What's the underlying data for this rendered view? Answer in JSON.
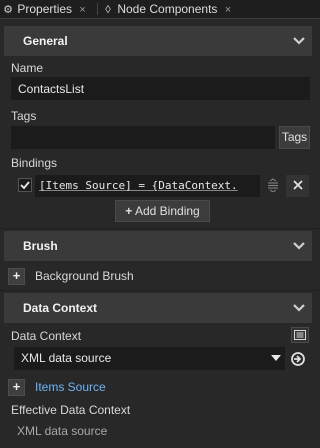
{
  "tabs": [
    {
      "label": "Properties",
      "icon": "gear-icon",
      "close": "×"
    },
    {
      "label": "Node Components",
      "icon": "components-icon",
      "close": "×"
    }
  ],
  "general": {
    "title": "General",
    "name_label": "Name",
    "name_value": "ContactsList",
    "tags_label": "Tags",
    "tags_value": "",
    "tags_button": "Tags",
    "bindings_label": "Bindings",
    "binding_text": "[Items Source] = {DataContext.",
    "binding_checked": true,
    "add_binding_label": "Add Binding"
  },
  "brush": {
    "title": "Brush",
    "background_brush_label": "Background Brush"
  },
  "data_context": {
    "title": "Data Context",
    "label": "Data Context",
    "selected": "XML data source",
    "items_source_label": "Items Source",
    "effective_label": "Effective Data Context",
    "effective_value": "XML data source"
  },
  "colors": {
    "background": "#282828",
    "section": "#3a3a3a",
    "link": "#6cb6f5"
  }
}
